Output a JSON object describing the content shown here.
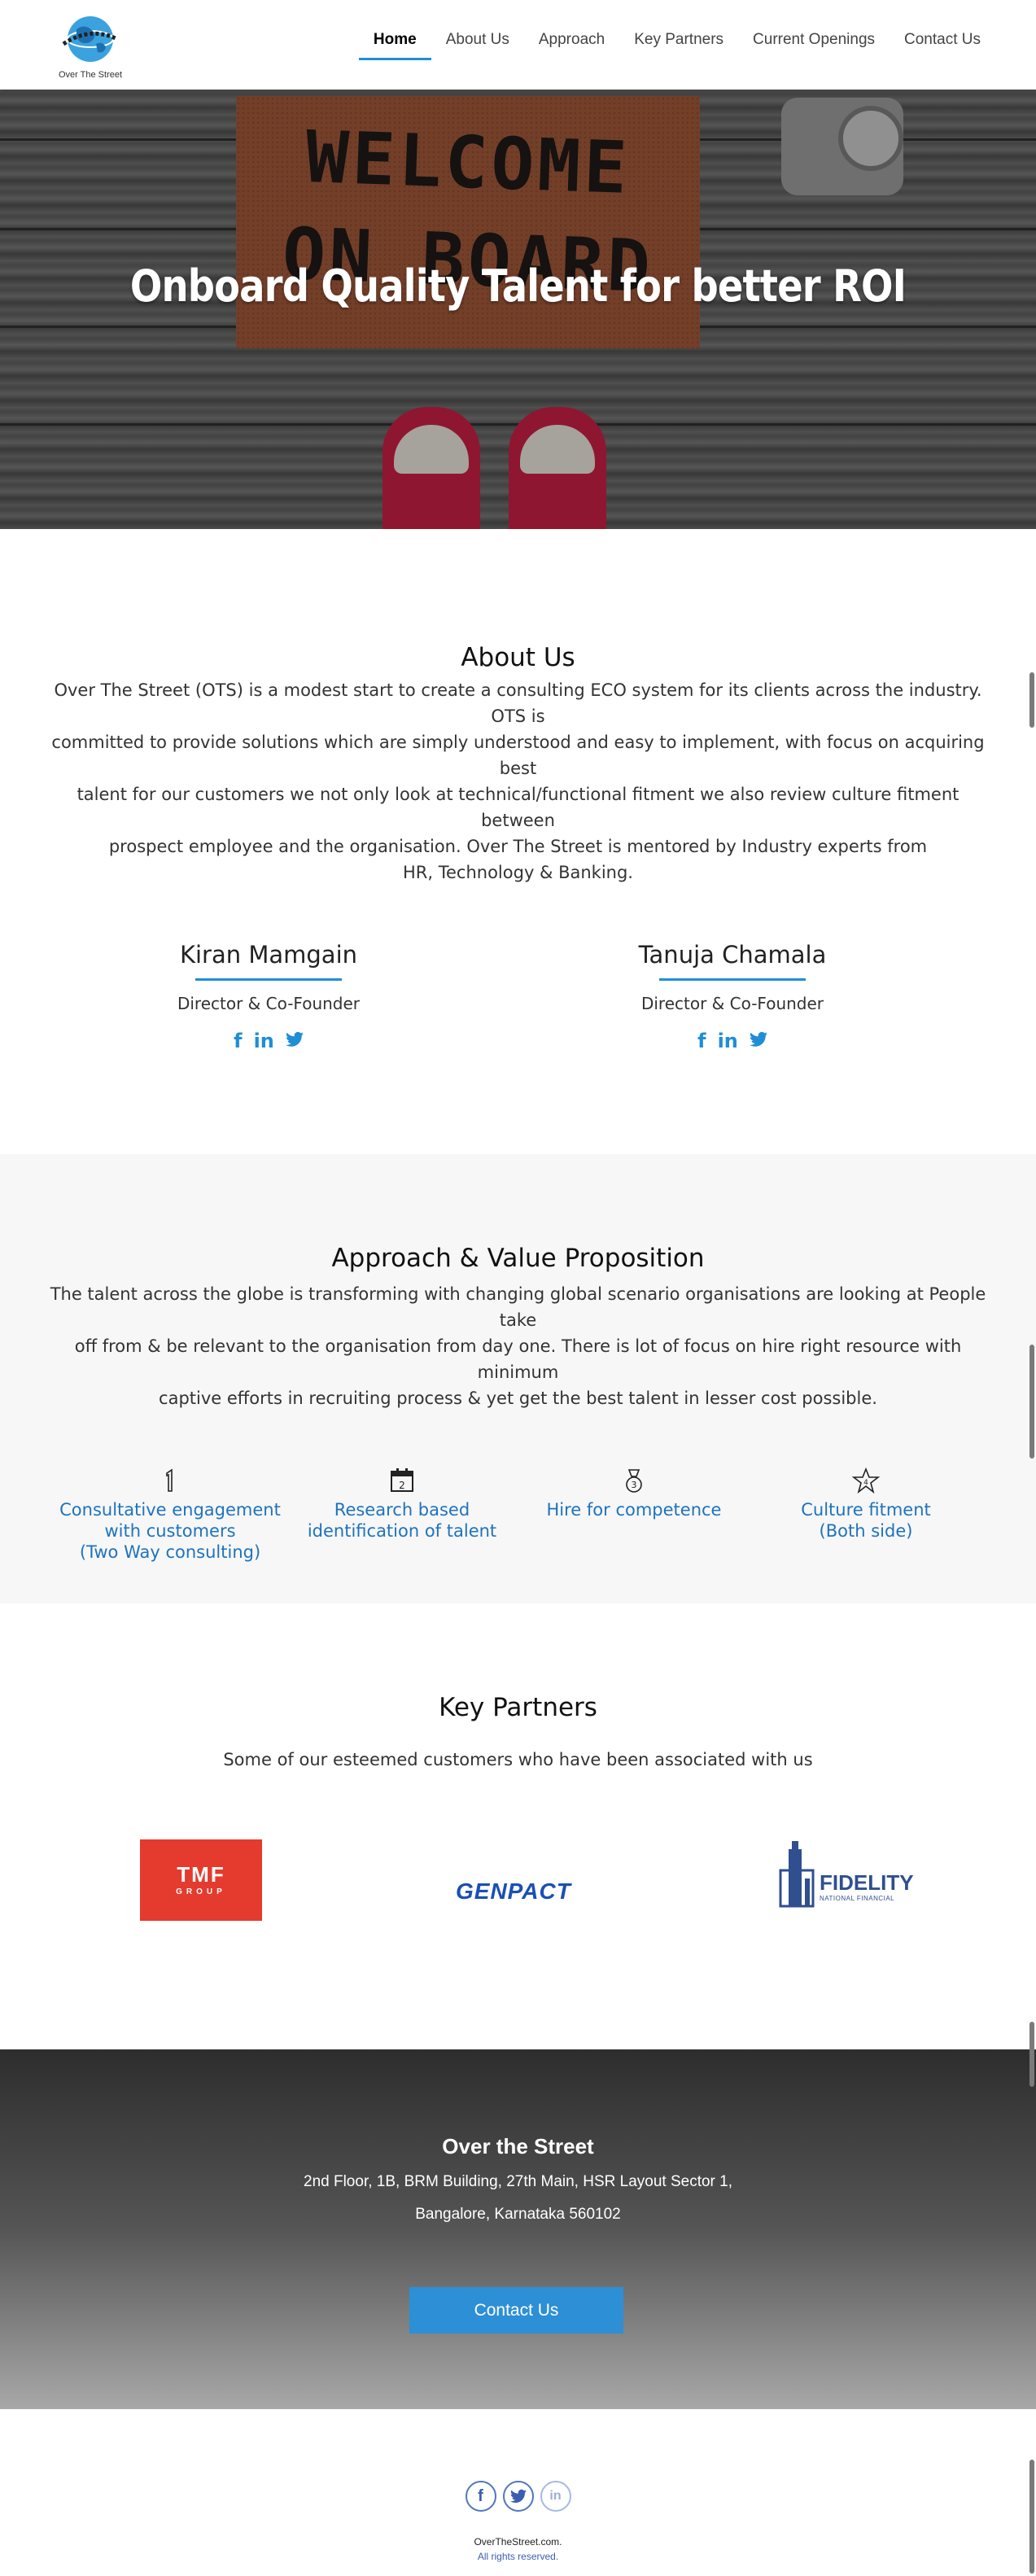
{
  "brand": {
    "logo_text": "Over The Street"
  },
  "nav": {
    "items": [
      {
        "label": "Home"
      },
      {
        "label": "About Us"
      },
      {
        "label": "Approach"
      },
      {
        "label": "Key Partners"
      },
      {
        "label": "Current Openings"
      },
      {
        "label": "Contact Us"
      }
    ],
    "active": "Home"
  },
  "hero": {
    "title": "Onboard Quality Talent for better ROI",
    "mat_line1": "WELCOME",
    "mat_line2": "ON BOARD"
  },
  "about": {
    "title": "About Us",
    "lines": [
      "Over The Street (OTS) is a modest start to create a consulting ECO system for its clients across the industry. OTS is",
      "committed to provide solutions which are simply understood and easy to implement, with focus on acquiring best",
      "talent for our customers we not only look at technical/functional fitment we also review culture fitment between",
      "prospect employee and the organisation. Over The Street is mentored by Industry experts from",
      "HR, Technology & Banking."
    ]
  },
  "people": [
    {
      "name": "Kiran Mamgain",
      "role": "Director & Co-Founder"
    },
    {
      "name": "Tanuja Chamala",
      "role": "Director & Co-Founder"
    }
  ],
  "approach": {
    "title": "Approach & Value Proposition",
    "lines": [
      "The talent across the globe is transforming with changing global scenario organisations are looking at People take",
      "off from & be relevant to the organisation from day one. There is lot of focus on hire right resource with minimum",
      "captive efforts in recruiting process & yet get the best talent in lesser cost possible."
    ],
    "features": [
      {
        "label": "Consultative engagement\nwith customers\n(Two Way consulting)",
        "icon": "number-one-icon"
      },
      {
        "label": "Research based\nidentification of talent",
        "icon": "calendar-icon"
      },
      {
        "label": "Hire for competence",
        "icon": "medal-icon"
      },
      {
        "label": "Culture fitment\n(Both side)",
        "icon": "star-icon"
      }
    ],
    "accent": "#1e73be"
  },
  "partners": {
    "title": "Key Partners",
    "subtitle": "Some of our esteemed customers who have been associated with us",
    "tmf_big": "TMF",
    "tmf_small": "GROUP",
    "genpact": "GENPACT",
    "fidelity": "FIDELITY",
    "fidelity_sub": "NATIONAL FINANCIAL"
  },
  "footer": {
    "company": "Over the Street",
    "address_line1": "2nd Floor, 1B, BRM Building, 27th Main, HSR Layout Sector 1,",
    "address_line2": "Bangalore, Karnataka 560102",
    "button": "Contact Us",
    "social": [
      "facebook-icon",
      "twitter-icon",
      "linkedin-icon"
    ],
    "site": "OverTheStreet.com.",
    "rights": "All rights reserved."
  },
  "colors": {
    "accent": "#1f8ed6",
    "button": "#2d8fd5",
    "tmf_red": "#e53a2e",
    "genpact_blue": "#1a4fb5",
    "fidelity_blue": "#2f4f8f"
  }
}
